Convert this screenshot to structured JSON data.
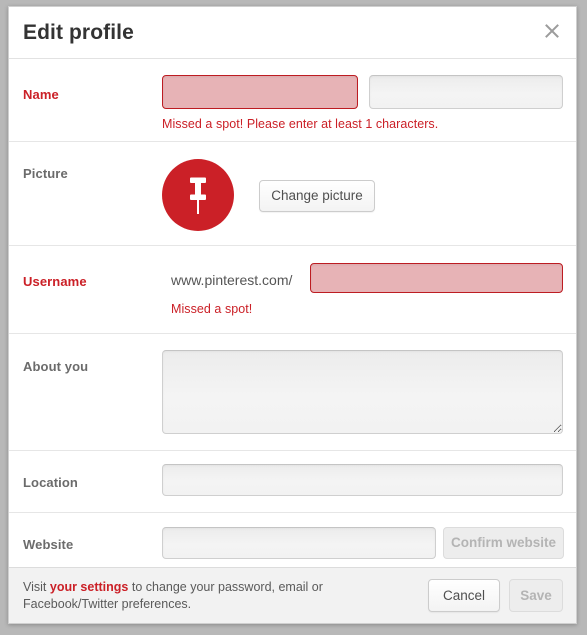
{
  "dialog": {
    "title": "Edit profile",
    "close_icon": "close-icon"
  },
  "rows": {
    "name": {
      "label": "Name",
      "first_value": "",
      "first_placeholder": "",
      "last_value": "",
      "last_placeholder": "",
      "error": "Missed a spot! Please enter at least 1 characters."
    },
    "picture": {
      "label": "Picture",
      "avatar_icon": "pin-icon",
      "avatar_color": "#cb2027",
      "change_button": "Change picture"
    },
    "username": {
      "label": "Username",
      "url_prefix": "www.pinterest.com/",
      "value": "",
      "placeholder": "",
      "error": "Missed a spot!"
    },
    "about": {
      "label": "About you",
      "value": "",
      "placeholder": ""
    },
    "location": {
      "label": "Location",
      "value": "",
      "placeholder": ""
    },
    "website": {
      "label": "Website",
      "value": "",
      "placeholder": "",
      "confirm_button": "Confirm website"
    }
  },
  "footer": {
    "text_before": "Visit ",
    "link": "your settings",
    "text_after": " to change your password, email or Facebook/Twitter preferences.",
    "cancel_label": "Cancel",
    "save_label": "Save"
  },
  "colors": {
    "brand_red": "#cb2027",
    "error_fill": "#e7b3b6",
    "error_border": "#bd1c22",
    "label_gray": "#6b6b6b"
  }
}
